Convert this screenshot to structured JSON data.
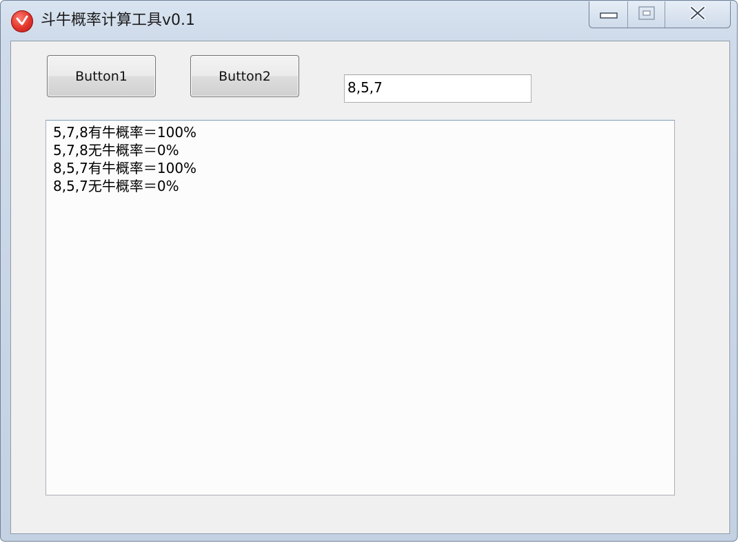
{
  "window": {
    "title": "斗牛概率计算工具v0.1",
    "icon": "app-logo-icon",
    "caption_buttons": [
      "minimize-icon",
      "maximize-icon",
      "close-icon"
    ]
  },
  "toolbar": {
    "button1_label": "Button1",
    "button2_label": "Button2",
    "input_value": "8,5,7"
  },
  "output": {
    "lines": [
      "5,7,8有牛概率＝100%",
      "5,7,8无牛概率＝0%",
      "8,5,7有牛概率＝100%",
      "8,5,7无牛概率＝0%"
    ]
  }
}
